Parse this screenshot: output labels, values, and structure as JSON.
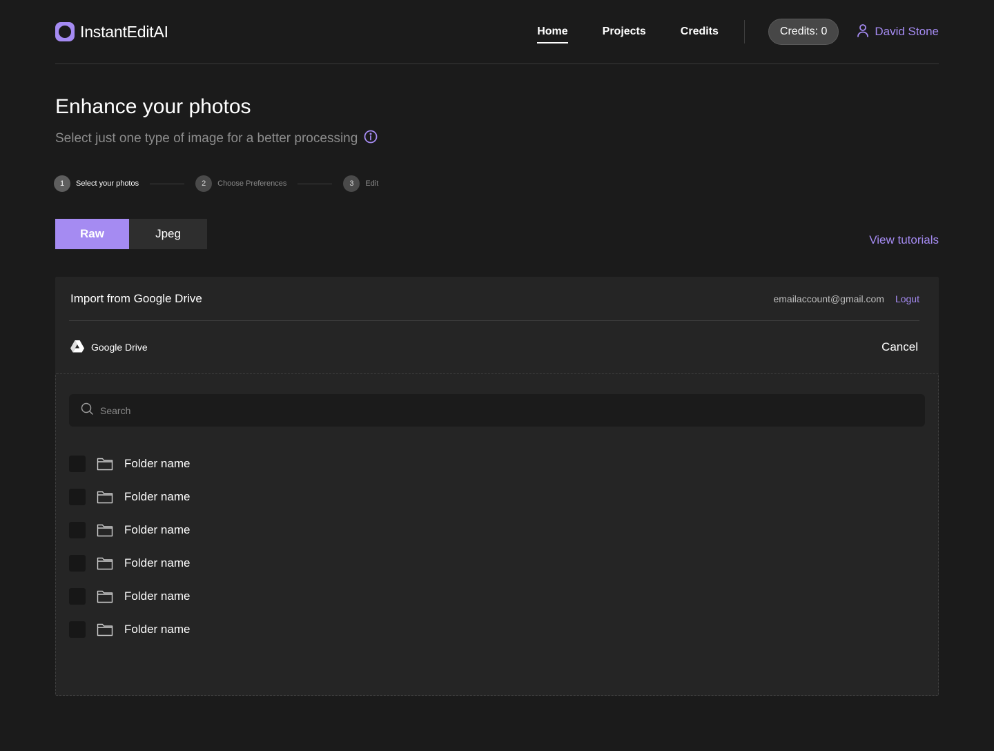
{
  "header": {
    "logo_text": "InstantEditAI",
    "nav": [
      {
        "label": "Home",
        "active": true
      },
      {
        "label": "Projects",
        "active": false
      },
      {
        "label": "Credits",
        "active": false
      }
    ],
    "credits_label": "Credits: 0",
    "user_name": "David Stone"
  },
  "page": {
    "title": "Enhance your photos",
    "subtitle": "Select just one type of image for a better processing"
  },
  "stepper": [
    {
      "number": "1",
      "label": "Select your photos"
    },
    {
      "number": "2",
      "label": "Choose Preferences"
    },
    {
      "number": "3",
      "label": "Edit"
    }
  ],
  "tabs": {
    "raw": "Raw",
    "jpeg": "Jpeg",
    "selected": "Raw"
  },
  "view_tutorials": "View tutorials",
  "import": {
    "title": "Import from Google Drive",
    "email": "emailaccount@gmail.com",
    "logout": "Logut",
    "source": "Google Drive",
    "cancel": "Cancel",
    "search_placeholder": "Search",
    "folders": [
      {
        "name": "Folder name"
      },
      {
        "name": "Folder name"
      },
      {
        "name": "Folder name"
      },
      {
        "name": "Folder name"
      },
      {
        "name": "Folder name"
      },
      {
        "name": "Folder name"
      }
    ]
  },
  "colors": {
    "accent": "#a58bf2",
    "background": "#1b1b1b",
    "panel": "#252525"
  }
}
